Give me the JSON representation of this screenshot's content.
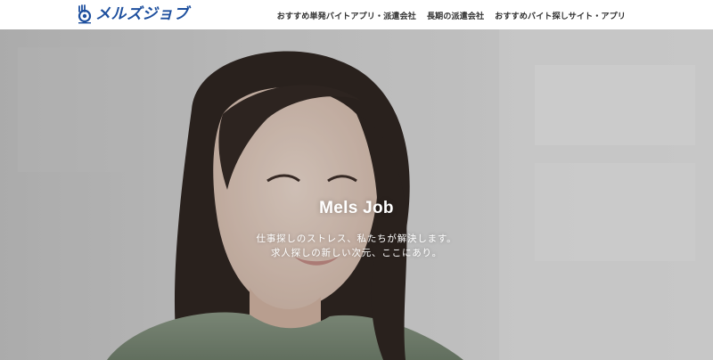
{
  "header": {
    "logo_text": "メルズジョブ",
    "nav": [
      {
        "label": "おすすめ単発バイトアプリ・派遣会社"
      },
      {
        "label": "長期の派遣会社"
      },
      {
        "label": "おすすめバイト探しサイト・アプリ"
      }
    ]
  },
  "hero": {
    "title": "Mels Job",
    "subtitle_line1": "仕事探しのストレス、私たちが解決します。",
    "subtitle_line2": "求人探しの新しい次元、ここにあり。"
  },
  "colors": {
    "brand": "#1d4f9e",
    "nav_text": "#333333",
    "hero_text": "#ffffff"
  },
  "icons": {
    "logo": "hand-logo-icon"
  }
}
